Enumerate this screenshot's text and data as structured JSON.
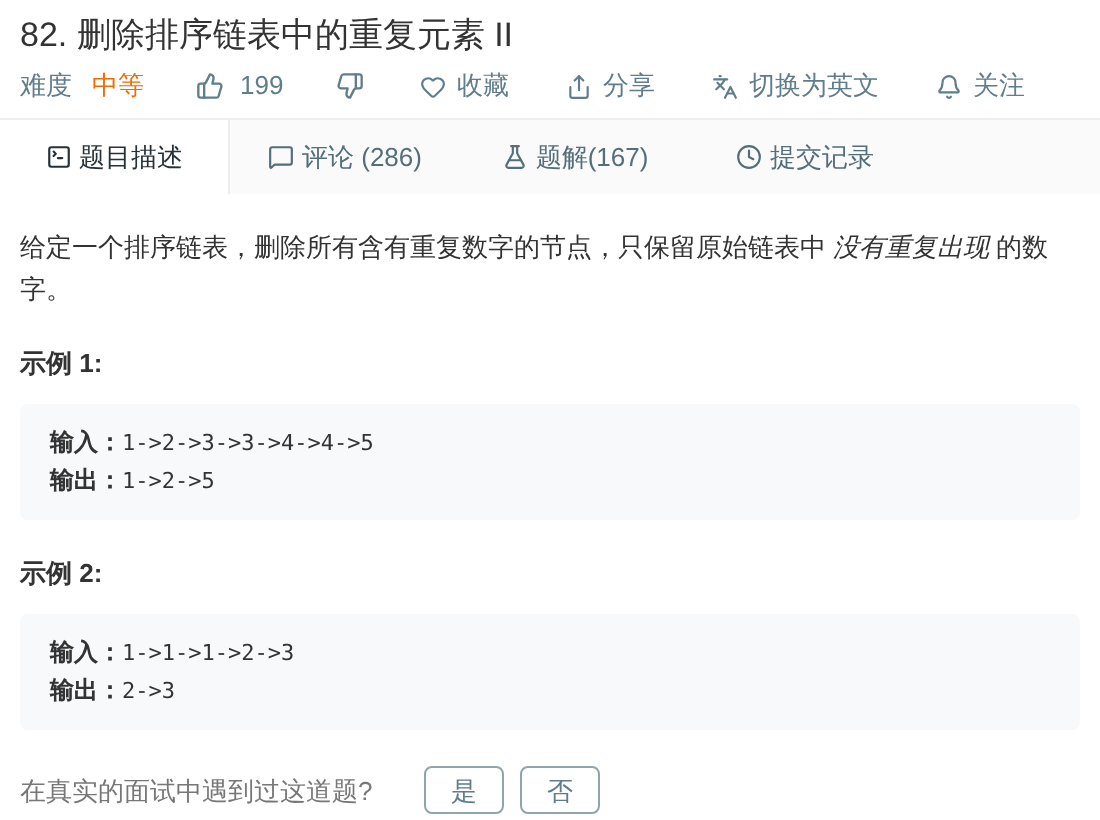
{
  "title": "82. 删除排序链表中的重复元素 II",
  "meta": {
    "difficulty_label": "难度",
    "difficulty": "中等",
    "likes": "199"
  },
  "actions": [
    {
      "kind": "favorite",
      "label": "收藏"
    },
    {
      "kind": "share",
      "label": "分享"
    },
    {
      "kind": "translate",
      "label": "切换为英文"
    },
    {
      "kind": "follow",
      "label": "关注"
    }
  ],
  "tabs": [
    {
      "kind": "description",
      "label": "题目描述",
      "selected": true
    },
    {
      "kind": "comments",
      "label": "评论 (286)",
      "selected": false
    },
    {
      "kind": "solutions",
      "label": "题解(167)",
      "selected": false
    },
    {
      "kind": "submissions",
      "label": "提交记录",
      "selected": false
    }
  ],
  "description": "给定一个排序链表，删除所有含有重复数字的节点，只保留原始链表中 *没有重复出现* 的数字。",
  "examples": [
    {
      "title": "示例 1:",
      "lines": [
        {
          "label": "输入：",
          "value": "1->2->3->3->4->4->5"
        },
        {
          "label": "输出：",
          "value": "1->2->5"
        }
      ]
    },
    {
      "title": "示例 2:",
      "lines": [
        {
          "label": "输入：",
          "value": "1->1->1->2->3"
        },
        {
          "label": "输出：",
          "value": "2->3"
        }
      ]
    }
  ],
  "question": {
    "text": "在真实的面试中遇到过这道题?",
    "buttons": [
      "是",
      "否"
    ]
  }
}
